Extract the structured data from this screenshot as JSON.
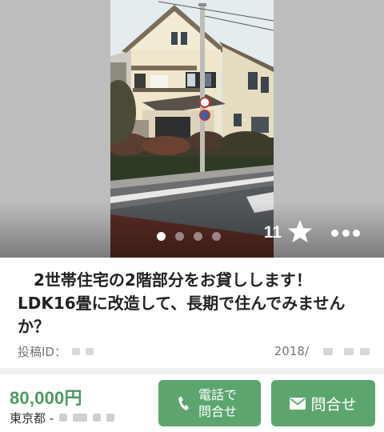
{
  "listing": {
    "title": "2世帯住宅の2階部分をお貸しします！LDK16畳に改造して、長期で住んでみませんか？",
    "post_id_label": "投稿ID：",
    "date_prefix": "2018/",
    "price": "80,000円",
    "location_prefix": "東京都 -"
  },
  "gallery": {
    "image_alt": "house-photo",
    "dots_count": 4,
    "active_dot": 0
  },
  "favorites": {
    "count": "11",
    "icon": "star-icon"
  },
  "menu": {
    "icon": "more-dots-icon"
  },
  "actions": {
    "phone_label_line1": "電話で",
    "phone_label_line2": "問合せ",
    "phone_icon": "phone-icon",
    "inquiry_label": "問合せ",
    "inquiry_icon": "mail-icon"
  },
  "colors": {
    "accent_green": "#5da56e",
    "price_green": "#4c9a62",
    "photo_backdrop": "#bdbdbd"
  }
}
